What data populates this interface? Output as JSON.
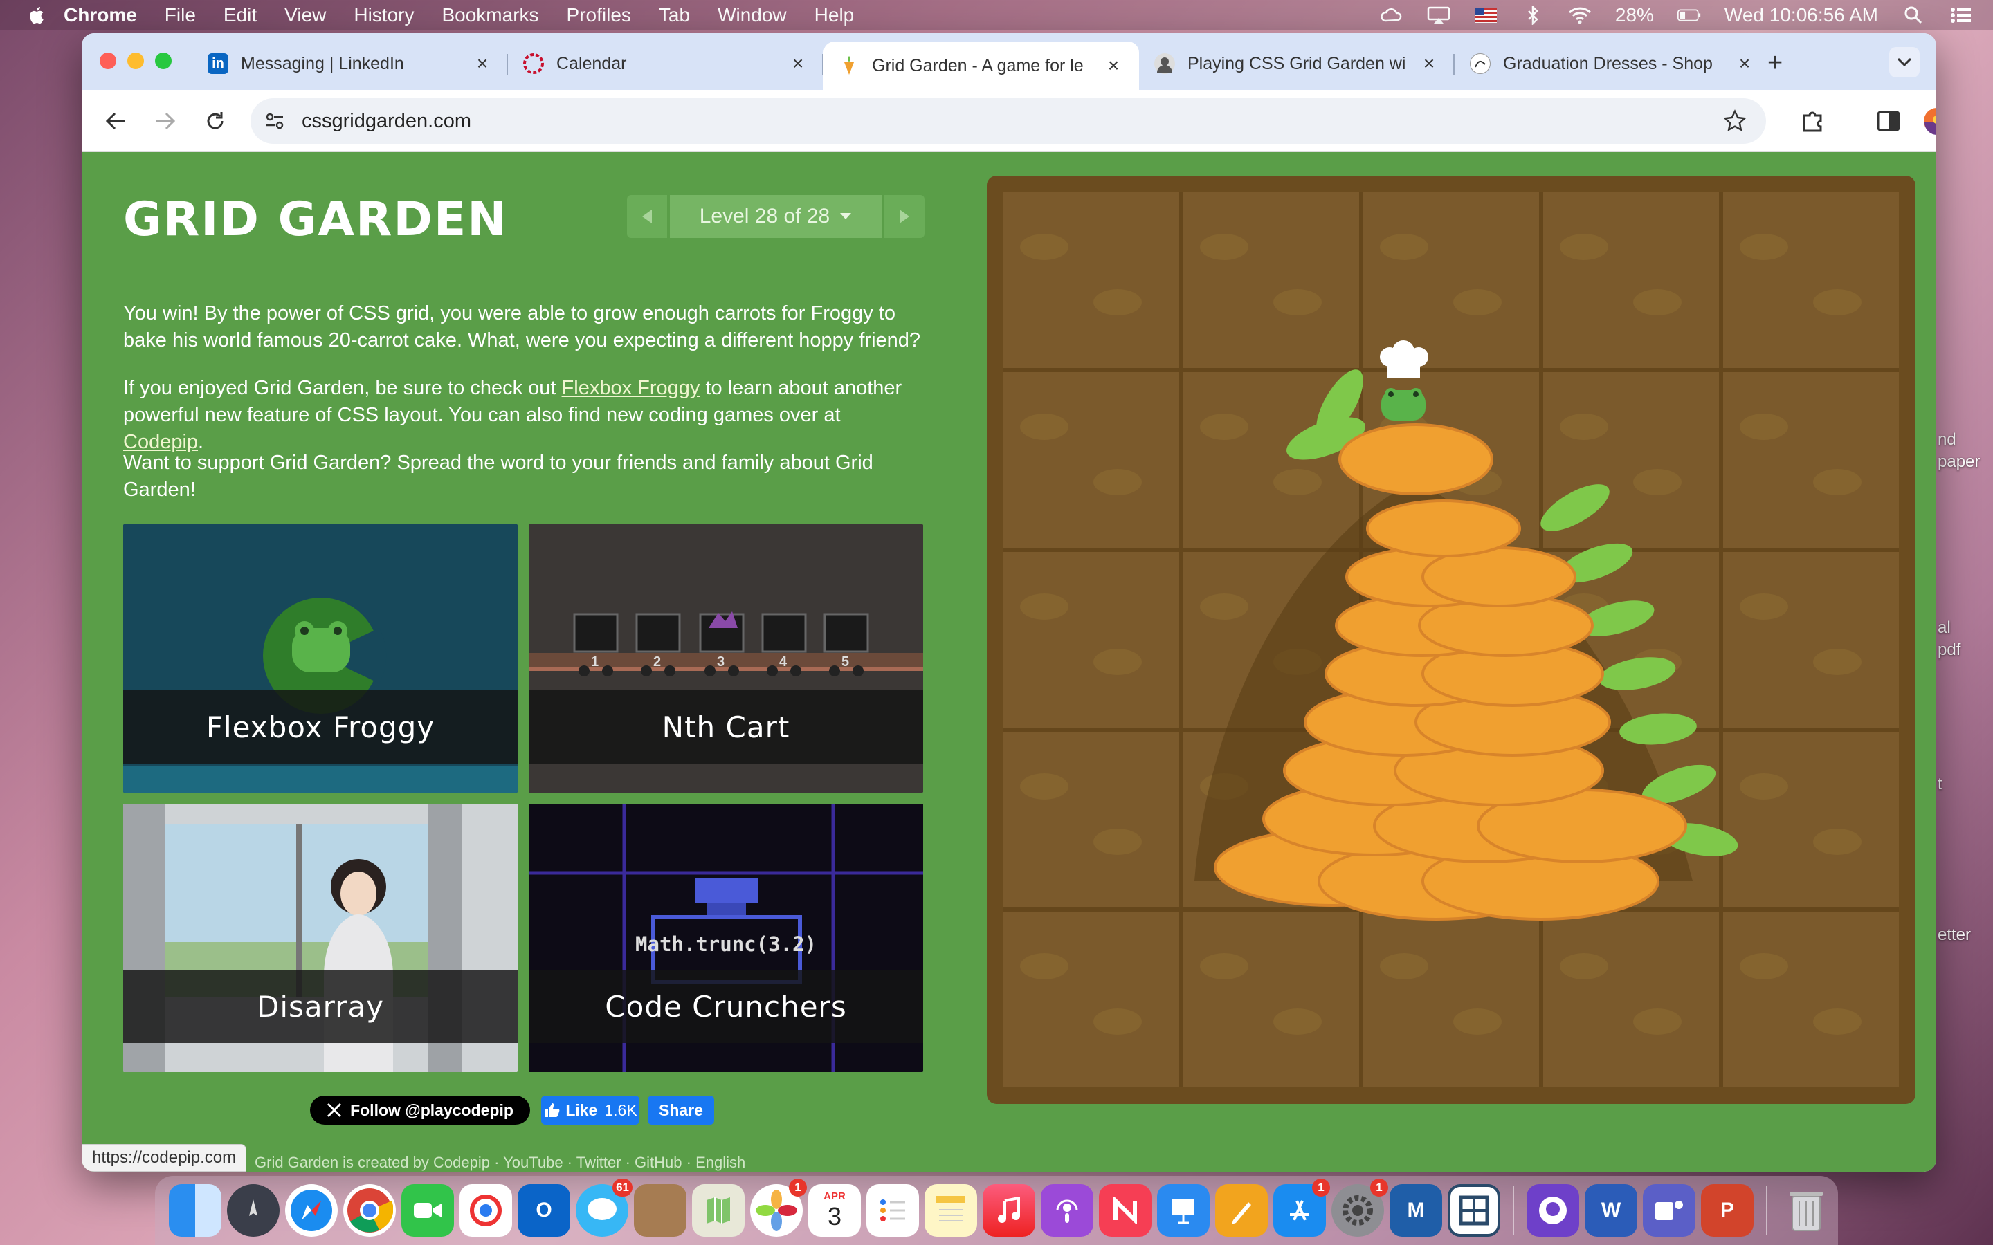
{
  "menubar": {
    "app": "Chrome",
    "items": [
      "File",
      "Edit",
      "View",
      "History",
      "Bookmarks",
      "Profiles",
      "Tab",
      "Window",
      "Help"
    ],
    "battery": "28%",
    "clock": "Wed 10:06:56 AM"
  },
  "desktop": {
    "labels": [
      "nd",
      "paper",
      "al",
      "pdf",
      "t",
      "etter"
    ]
  },
  "tabs": [
    {
      "title": "Messaging | LinkedIn",
      "favicon": "in",
      "color": "#0a66c2"
    },
    {
      "title": "Calendar",
      "favicon": "",
      "color": "#c8102e"
    },
    {
      "title": "Grid Garden - A game for le",
      "favicon": "",
      "color": "#5a9e48"
    },
    {
      "title": "Playing CSS Grid Garden wi",
      "favicon": "",
      "color": "#666666"
    },
    {
      "title": "Graduation Dresses - Shop",
      "favicon": "",
      "color": "#888888"
    }
  ],
  "address": "cssgridgarden.com",
  "game": {
    "title": "GRID GARDEN",
    "level": "Level 28 of 28",
    "p1": "You win! By the power of CSS grid, you were able to grow enough carrots for Froggy to bake his world famous 20-carrot cake. What, were you expecting a different hoppy friend?",
    "p2_a": "If you enjoyed Grid Garden, be sure to check out ",
    "p2_link1": "Flexbox Froggy",
    "p2_b": " to learn about another powerful new feature of CSS layout. You can also find new coding games over at ",
    "p2_link2": "Codepip",
    "p2_c": ".",
    "p3": "Want to support Grid Garden? Spread the word to your friends and family about Grid Garden!",
    "cards": [
      "Flexbox Froggy",
      "Nth Cart",
      "Disarray",
      "Code Crunchers"
    ],
    "cart_numbers": [
      "1",
      "2",
      "3",
      "4",
      "5"
    ],
    "code_text": "Math.trunc(3.2)",
    "follow": "Follow @playcodepip",
    "like": "Like",
    "like_count": "1.6K",
    "share": "Share"
  },
  "statusbar": "https://codepip.com",
  "footer_hint": "Grid Garden is created by Codepip · YouTube · Twitter · GitHub · English",
  "dock": {
    "badges": {
      "messages": "61",
      "photos": "1",
      "appstore": "1",
      "settings": "1"
    },
    "calendar_month": "APR",
    "calendar_day": "3",
    "word": "W",
    "ppt": "P",
    "aya": "M"
  }
}
